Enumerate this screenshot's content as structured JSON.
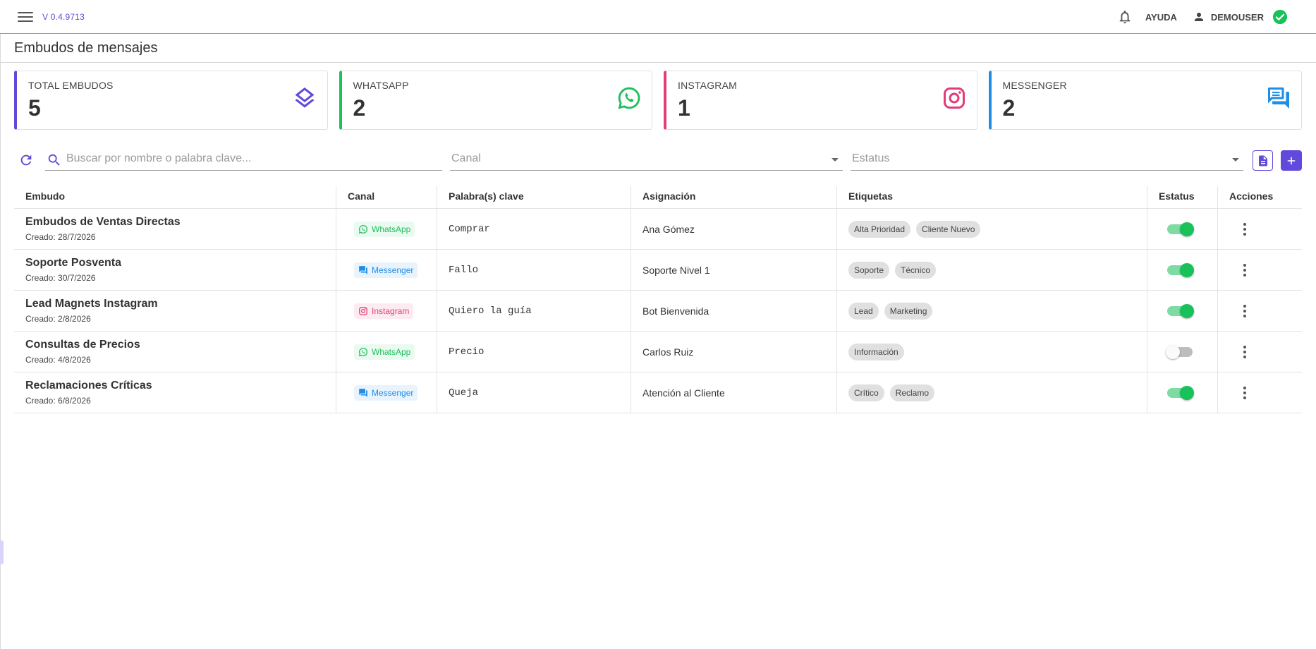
{
  "header": {
    "version": "V 0.4.9713",
    "help_label": "AYUDA",
    "user_name": "DEMOUSER"
  },
  "page": {
    "title": "Embudos de mensajes"
  },
  "stats": [
    {
      "label": "TOTAL EMBUDOS",
      "value": "5",
      "color": "#5e4bd6",
      "icon": "layers-icon"
    },
    {
      "label": "WHATSAPP",
      "value": "2",
      "color": "#1ec05c",
      "icon": "whatsapp-icon"
    },
    {
      "label": "INSTAGRAM",
      "value": "1",
      "color": "#e23d7a",
      "icon": "instagram-icon"
    },
    {
      "label": "MESSENGER",
      "value": "2",
      "color": "#1f8ee6",
      "icon": "messenger-icon"
    }
  ],
  "toolbar": {
    "search_placeholder": "Buscar por nombre o palabra clave...",
    "canal_placeholder": "Canal",
    "status_placeholder": "Estatus"
  },
  "table": {
    "columns": [
      "Embudo",
      "Canal",
      "Palabra(s) clave",
      "Asignación",
      "Etiquetas",
      "Estatus",
      "Acciones"
    ],
    "rows": [
      {
        "name": "Embudos de Ventas Directas",
        "created": "Creado: 28/7/2026",
        "channel": "WhatsApp",
        "keyword": "Comprar",
        "assignment": "Ana Gómez",
        "tags": [
          "Alta Prioridad",
          "Cliente Nuevo"
        ],
        "active": true
      },
      {
        "name": "Soporte Posventa",
        "created": "Creado: 30/7/2026",
        "channel": "Messenger",
        "keyword": "Fallo",
        "assignment": "Soporte Nivel 1",
        "tags": [
          "Soporte",
          "Técnico"
        ],
        "active": true
      },
      {
        "name": "Lead Magnets Instagram",
        "created": "Creado: 2/8/2026",
        "channel": "Instagram",
        "keyword": "Quiero la guía",
        "assignment": "Bot Bienvenida",
        "tags": [
          "Lead",
          "Marketing"
        ],
        "active": true
      },
      {
        "name": "Consultas de Precios",
        "created": "Creado: 4/8/2026",
        "channel": "WhatsApp",
        "keyword": "Precio",
        "assignment": "Carlos Ruiz",
        "tags": [
          "Información"
        ],
        "active": false
      },
      {
        "name": "Reclamaciones Críticas",
        "created": "Creado: 6/8/2026",
        "channel": "Messenger",
        "keyword": "Queja",
        "assignment": "Atención al Cliente",
        "tags": [
          "Crítico",
          "Reclamo"
        ],
        "active": true
      }
    ]
  },
  "channel_colors": {
    "WhatsApp": {
      "text": "#1ec05c",
      "bg": "#eafaf0"
    },
    "Messenger": {
      "text": "#1f8ee6",
      "bg": "#e8f3fd"
    },
    "Instagram": {
      "text": "#e23d7a",
      "bg": "#fdebf2"
    }
  },
  "accent_color": "#5e4bd6"
}
